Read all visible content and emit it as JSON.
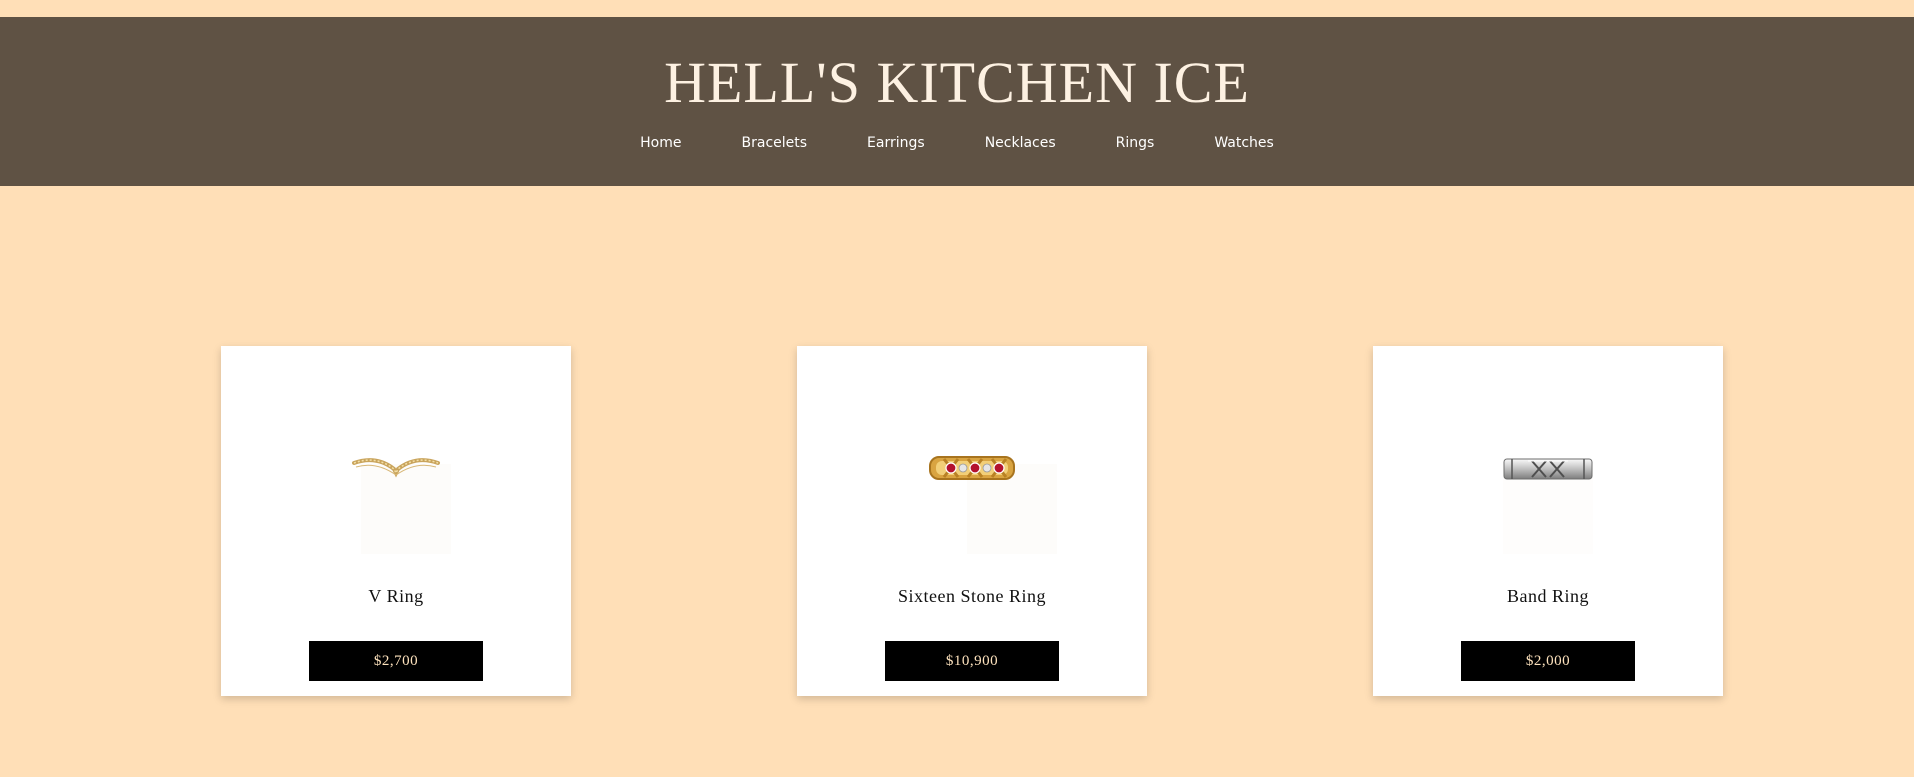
{
  "header": {
    "title": "HELL'S KITCHEN ICE",
    "nav": [
      "Home",
      "Bracelets",
      "Earrings",
      "Necklaces",
      "Rings",
      "Watches"
    ]
  },
  "products": [
    {
      "name": "V Ring",
      "price": "$2,700",
      "image": "gold-v-ring-image"
    },
    {
      "name": "Sixteen Stone Ring",
      "price": "$10,900",
      "image": "ruby-diamond-x-band-image"
    },
    {
      "name": "Band Ring",
      "price": "$2,000",
      "image": "silver-x-band-image"
    }
  ],
  "colors": {
    "page_background": "#ffdfb7",
    "header_background": "#5f5244",
    "title_color": "#fdf1e2",
    "button_background": "#000000",
    "button_text": "#fde2bd"
  }
}
